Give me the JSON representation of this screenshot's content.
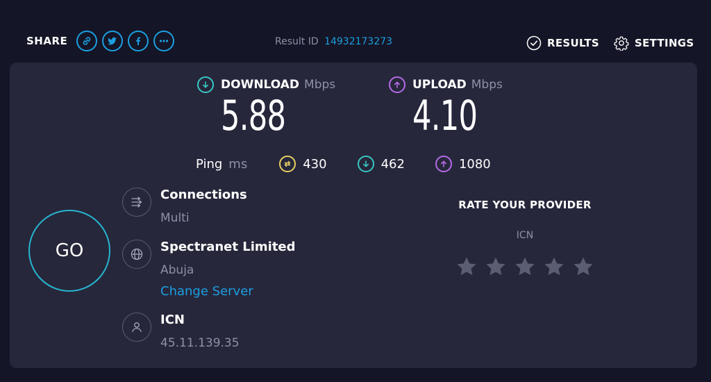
{
  "header": {
    "share_label": "SHARE",
    "share_buttons": [
      "link-icon",
      "twitter-icon",
      "facebook-icon",
      "more-icon"
    ],
    "result_id_label": "Result ID",
    "result_id_value": "14932173273",
    "results_label": "RESULTS",
    "settings_label": "SETTINGS"
  },
  "speeds": {
    "download": {
      "label": "DOWNLOAD",
      "unit": "Mbps",
      "value": "5.88"
    },
    "upload": {
      "label": "UPLOAD",
      "unit": "Mbps",
      "value": "4.10"
    }
  },
  "ping": {
    "label": "Ping",
    "unit": "ms",
    "idle": "430",
    "download": "462",
    "upload": "1080"
  },
  "go_label": "GO",
  "connections": {
    "title": "Connections",
    "value": "Multi"
  },
  "server": {
    "name": "Spectranet Limited",
    "location": "Abuja",
    "change_label": "Change Server"
  },
  "isp": {
    "name": "ICN",
    "ip": "45.11.139.35"
  },
  "rate": {
    "title": "RATE YOUR PROVIDER",
    "provider": "ICN",
    "stars": 5
  },
  "colors": {
    "background": "#141526",
    "panel": "#26273b",
    "accent_blue": "#1c9fe0",
    "download": "#39c6c2",
    "upload": "#b66ae8",
    "idle_ping": "#e8d063",
    "go_ring": "#27b5cf",
    "muted_text": "#8d90a8"
  }
}
